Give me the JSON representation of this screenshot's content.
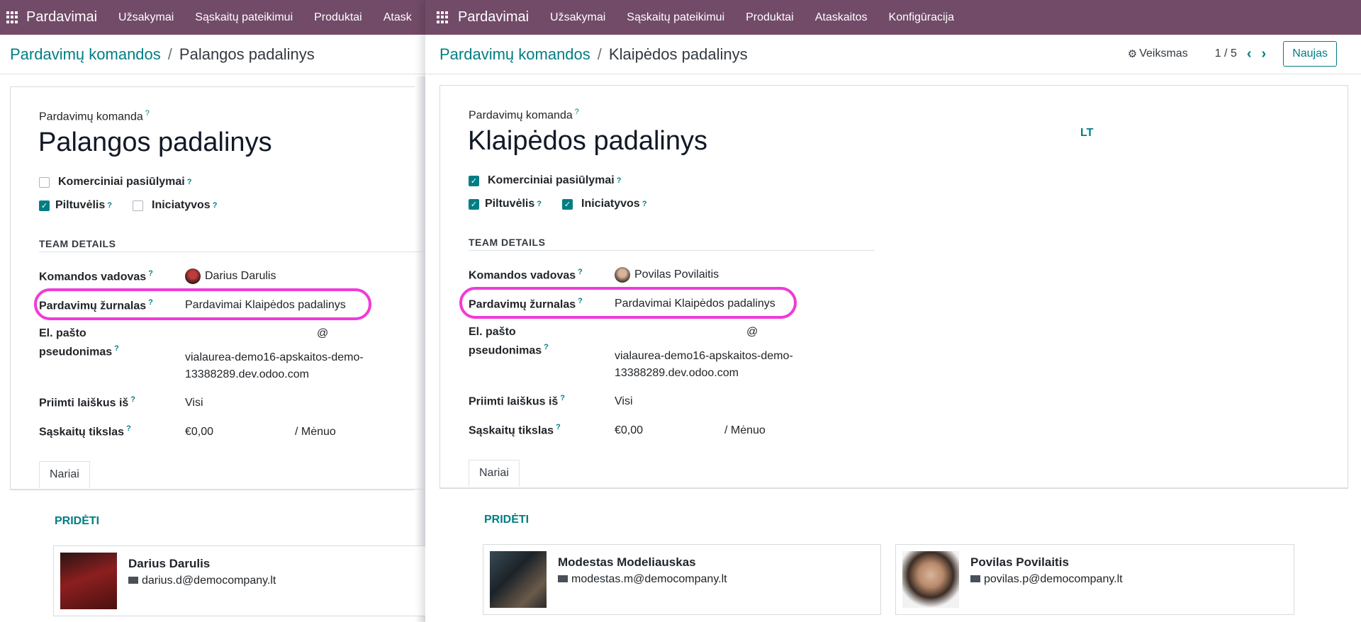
{
  "colors": {
    "topbar": "#714b67",
    "accent": "#017e84",
    "highlight": "#f03bd8"
  },
  "left": {
    "topbar": {
      "brand": "Pardavimai",
      "menu": [
        "Užsakymai",
        "Sąskaitų pateikimui",
        "Produktai",
        "Atask"
      ]
    },
    "breadcrumb": {
      "parent": "Pardavimų komandos",
      "sep": "/",
      "current": "Palangos padalinys"
    },
    "form": {
      "team_label": "Pardavimų komanda",
      "name": "Palangos padalinys",
      "opts": {
        "quotations": {
          "label": "Komerciniai pasiūlymai",
          "checked": false
        },
        "pipeline": {
          "label": "Piltuvėlis",
          "checked": true
        },
        "leads": {
          "label": "Iniciatyvos",
          "checked": false
        }
      },
      "section": "TEAM DETAILS",
      "leader_label": "Komandos vadovas",
      "leader": "Darius Darulis",
      "journal_label": "Pardavimų žurnalas",
      "journal": "Pardavimai Klaipėdos padalinys",
      "alias_label_1": "El. pašto",
      "alias_label_2": "pseudonimas",
      "alias_at": "@",
      "alias_domain_1": "vialaurea-demo16-apskaitos-demo-",
      "alias_domain_2": "13388289.dev.odoo.com",
      "accept_label": "Priimti laiškus iš",
      "accept": "Visi",
      "target_label": "Sąskaitų tikslas",
      "target": "€0,00",
      "period": "/ Mėnuo",
      "tab": "Nariai",
      "add": "PRIDĖTI",
      "members": [
        {
          "name": "Darius Darulis",
          "email": "darius.d@democompany.lt"
        }
      ]
    }
  },
  "right": {
    "topbar": {
      "brand": "Pardavimai",
      "menu": [
        "Užsakymai",
        "Sąskaitų pateikimui",
        "Produktai",
        "Ataskaitos",
        "Konfigūracija"
      ]
    },
    "breadcrumb": {
      "parent": "Pardavimų komandos",
      "sep": "/",
      "current": "Klaipėdos padalinys"
    },
    "controls": {
      "action": "Veiksmas",
      "pager": "1 / 5",
      "new": "Naujas"
    },
    "form": {
      "team_label": "Pardavimų komanda",
      "name": "Klaipėdos padalinys",
      "lang": "LT",
      "opts": {
        "quotations": {
          "label": "Komerciniai pasiūlymai",
          "checked": true
        },
        "pipeline": {
          "label": "Piltuvėlis",
          "checked": true
        },
        "leads": {
          "label": "Iniciatyvos",
          "checked": true
        }
      },
      "section": "TEAM DETAILS",
      "leader_label": "Komandos vadovas",
      "leader": "Povilas Povilaitis",
      "journal_label": "Pardavimų žurnalas",
      "journal": "Pardavimai Klaipėdos padalinys",
      "alias_label_1": "El. pašto",
      "alias_label_2": "pseudonimas",
      "alias_at": "@",
      "alias_domain_1": "vialaurea-demo16-apskaitos-demo-",
      "alias_domain_2": "13388289.dev.odoo.com",
      "accept_label": "Priimti laiškus iš",
      "accept": "Visi",
      "target_label": "Sąskaitų tikslas",
      "target": "€0,00",
      "period": "/ Mėnuo",
      "tab": "Nariai",
      "add": "PRIDĖTI",
      "members": [
        {
          "name": "Modestas Modeliauskas",
          "email": "modestas.m@democompany.lt"
        },
        {
          "name": "Povilas Povilaitis",
          "email": "povilas.p@democompany.lt"
        }
      ]
    }
  }
}
